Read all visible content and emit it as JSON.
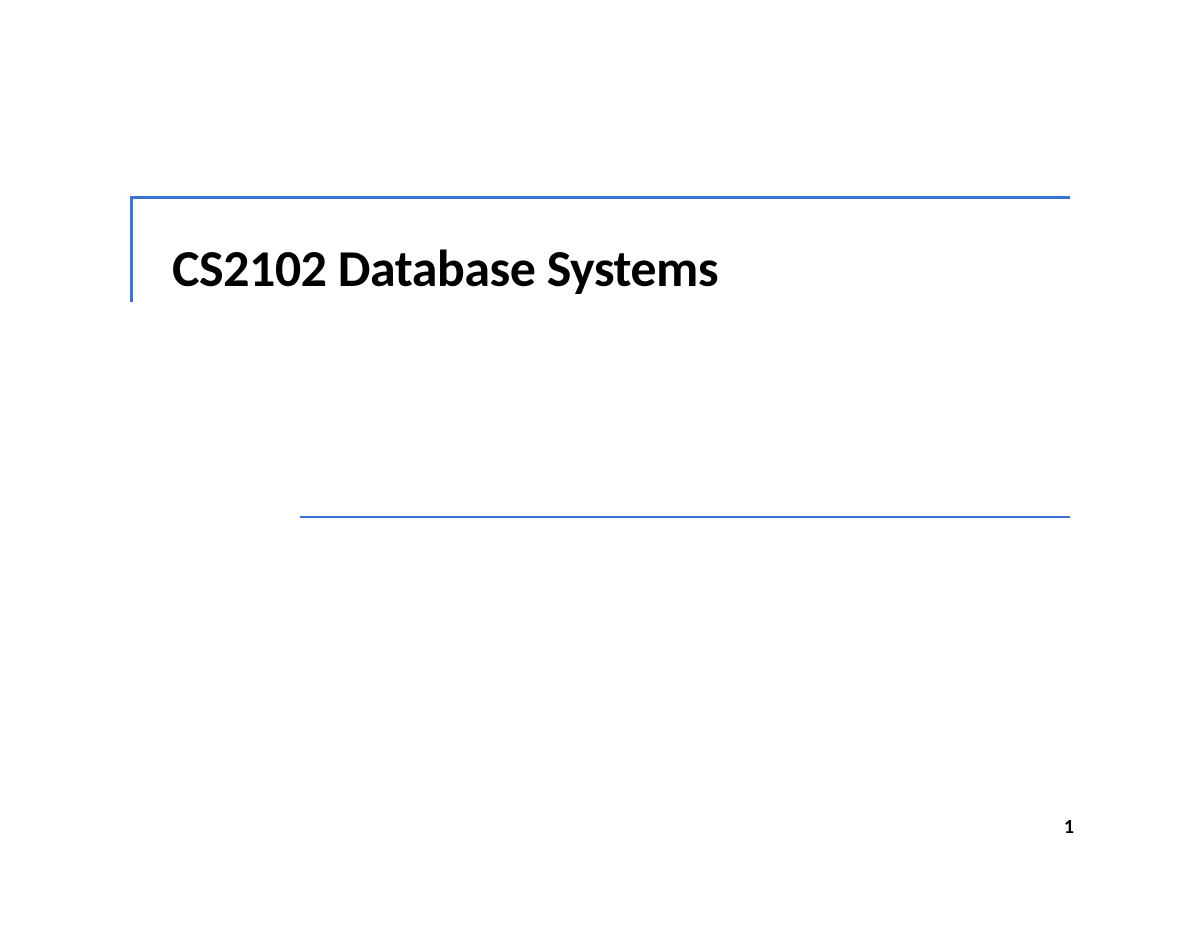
{
  "slide": {
    "title": "CS2102 Database Systems",
    "page_number": "1"
  }
}
